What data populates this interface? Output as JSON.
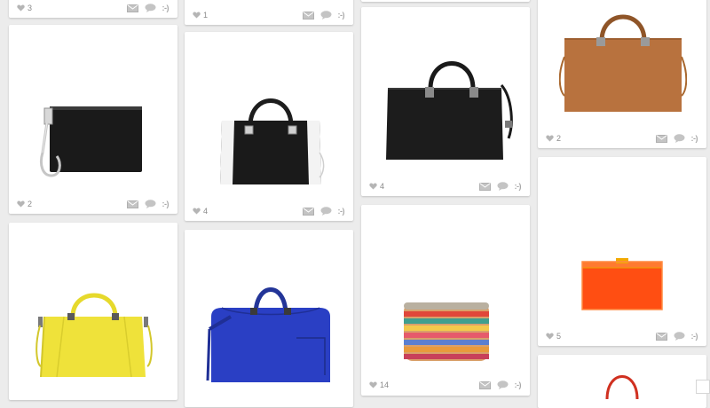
{
  "cards": [
    {
      "id": "c1",
      "likes": "3",
      "item": "top-cropped-bag"
    },
    {
      "id": "c2",
      "likes": "1",
      "item": "top-cropped-bag"
    },
    {
      "id": "c3",
      "likes": "",
      "item": "top-cropped-bag"
    },
    {
      "id": "c4",
      "likes": "2",
      "item": "tan-structured-tote"
    },
    {
      "id": "c5",
      "likes": "2",
      "item": "black-zip-clutch"
    },
    {
      "id": "c6",
      "likes": "4",
      "item": "black-white-bowling-bag"
    },
    {
      "id": "c7",
      "likes": "4",
      "item": "black-city-bag"
    },
    {
      "id": "c8",
      "likes": "",
      "item": "yellow-tote"
    },
    {
      "id": "c9",
      "likes": "",
      "item": "blue-duffle-bag"
    },
    {
      "id": "c10",
      "likes": "14",
      "item": "embroidered-box-clutch"
    },
    {
      "id": "c11",
      "likes": "5",
      "item": "orange-perspex-clutch"
    },
    {
      "id": "c12",
      "likes": "",
      "item": "red-handle-bag"
    }
  ],
  "action_labels": {
    "smiley": ":-)"
  },
  "colors": {
    "background": "#ececec",
    "card": "#ffffff",
    "icon": "#b5b5b5",
    "tan_bag": "#b8723e",
    "black_bag": "#1a1a1a",
    "yellow_bag": "#efe23a",
    "blue_bag": "#2a3fc4",
    "orange_clutch": "#ff4e12"
  }
}
